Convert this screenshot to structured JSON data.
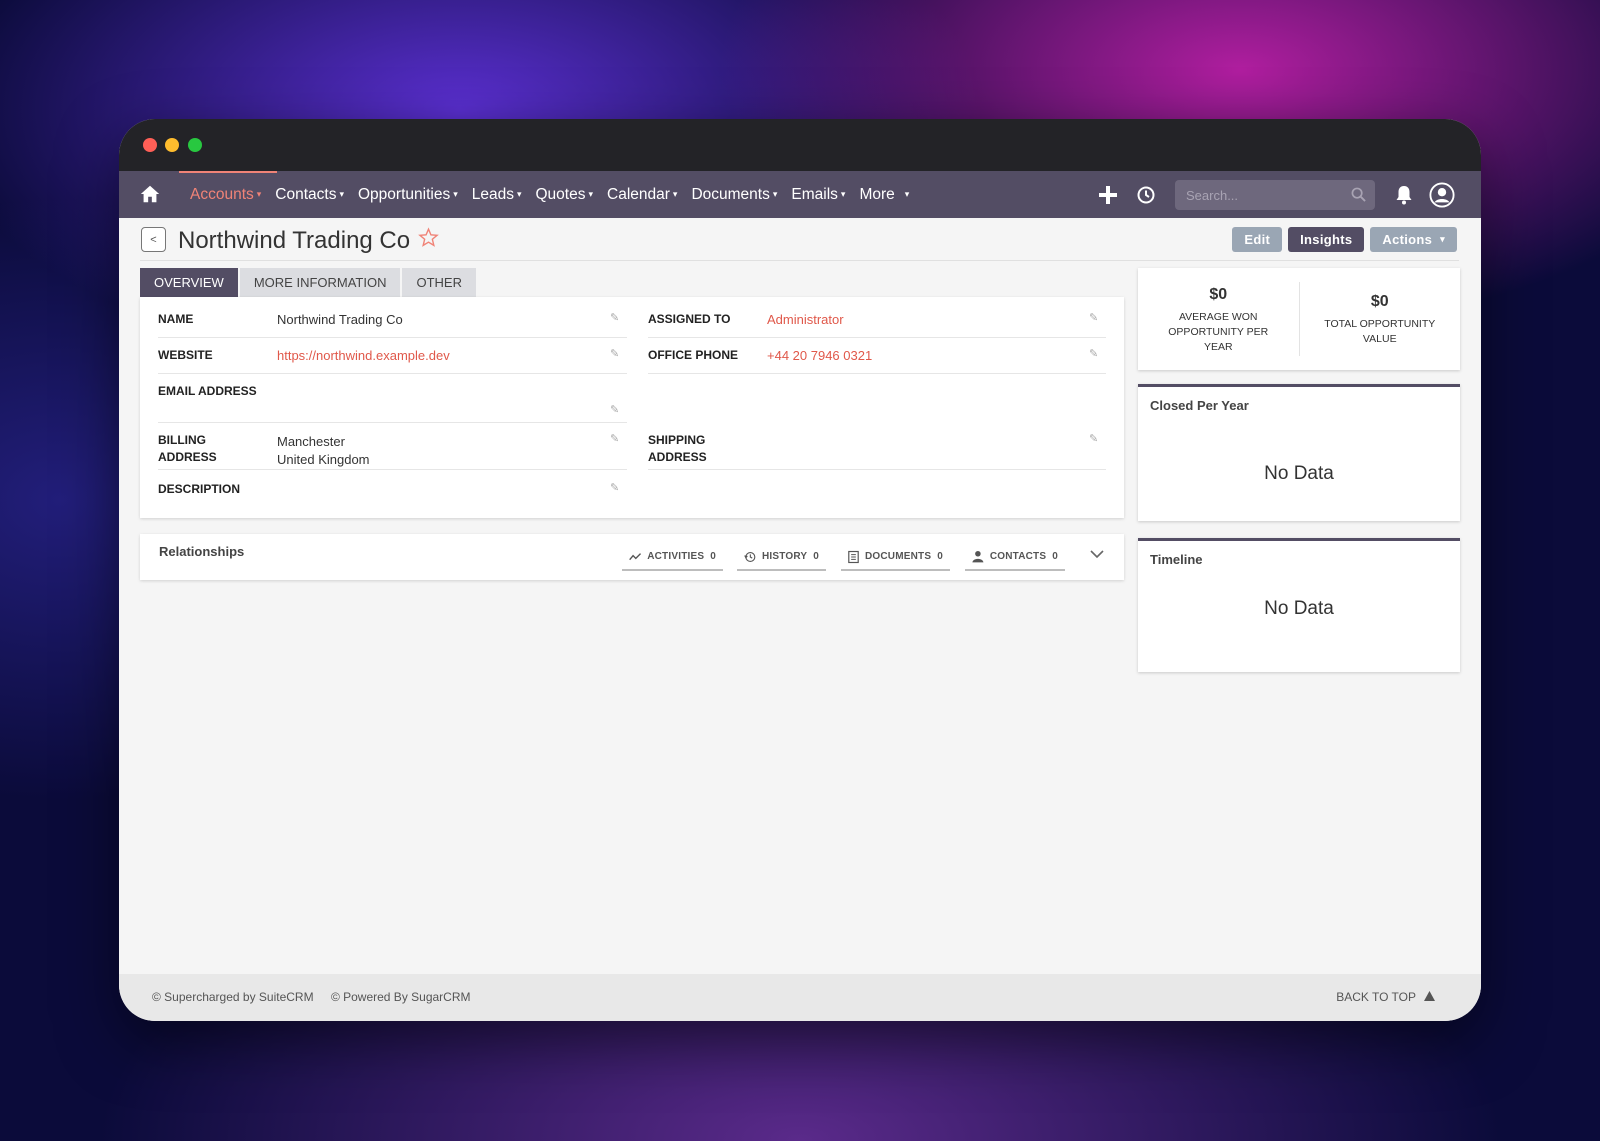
{
  "nav": {
    "items": [
      {
        "label": "Accounts",
        "active": true
      },
      {
        "label": "Contacts",
        "active": false
      },
      {
        "label": "Opportunities",
        "active": false
      },
      {
        "label": "Leads",
        "active": false
      },
      {
        "label": "Quotes",
        "active": false
      },
      {
        "label": "Calendar",
        "active": false
      },
      {
        "label": "Documents",
        "active": false
      },
      {
        "label": "Emails",
        "active": false
      },
      {
        "label": "More",
        "active": false
      }
    ],
    "search_placeholder": "Search...",
    "caret": "▾"
  },
  "header": {
    "title": "Northwind Trading Co",
    "back_label": "<",
    "edit": "Edit",
    "insights": "Insights",
    "actions": "Actions",
    "actions_caret": "▾"
  },
  "tabs": [
    "OVERVIEW",
    "MORE INFORMATION",
    "OTHER"
  ],
  "fields": {
    "name_label": "NAME",
    "name_value": "Northwind Trading Co",
    "website_label": "WEBSITE",
    "website_value": "https://northwind.example.dev",
    "email_label": "EMAIL ADDRESS",
    "billing_label_1": "BILLING",
    "billing_label_2": "ADDRESS",
    "billing_line_1": "Manchester",
    "billing_line_2": "United Kingdom",
    "description_label": "DESCRIPTION",
    "assigned_label": "ASSIGNED TO",
    "assigned_value": "Administrator",
    "phone_label": "OFFICE PHONE",
    "phone_value": "+44 20 7946 0321",
    "shipping_label_1": "SHIPPING",
    "shipping_label_2": "ADDRESS"
  },
  "relationships": {
    "title": "Relationships",
    "tabs": [
      {
        "label": "ACTIVITIES",
        "count": "0",
        "icon": "activity-icon"
      },
      {
        "label": "HISTORY",
        "count": "0",
        "icon": "history-icon"
      },
      {
        "label": "DOCUMENTS",
        "count": "0",
        "icon": "document-icon"
      },
      {
        "label": "CONTACTS",
        "count": "0",
        "icon": "person-icon"
      }
    ]
  },
  "insights": {
    "avg_won_value": "$0",
    "avg_won_caption": "AVERAGE WON OPPORTUNITY PER YEAR",
    "total_value": "$0",
    "total_caption": "TOTAL OPPORTUNITY VALUE",
    "closed_title": "Closed Per Year",
    "closed_nodata": "No Data",
    "timeline_title": "Timeline",
    "timeline_nodata": "No Data"
  },
  "footer": {
    "supercharged": "© Supercharged by SuiteCRM",
    "powered": "© Powered By SugarCRM",
    "back_to_top": "BACK TO TOP"
  },
  "colors": {
    "nav_bg": "#534d64",
    "accent": "#f08377",
    "link": "#e0584a",
    "page_bg": "#f5f5f5"
  }
}
